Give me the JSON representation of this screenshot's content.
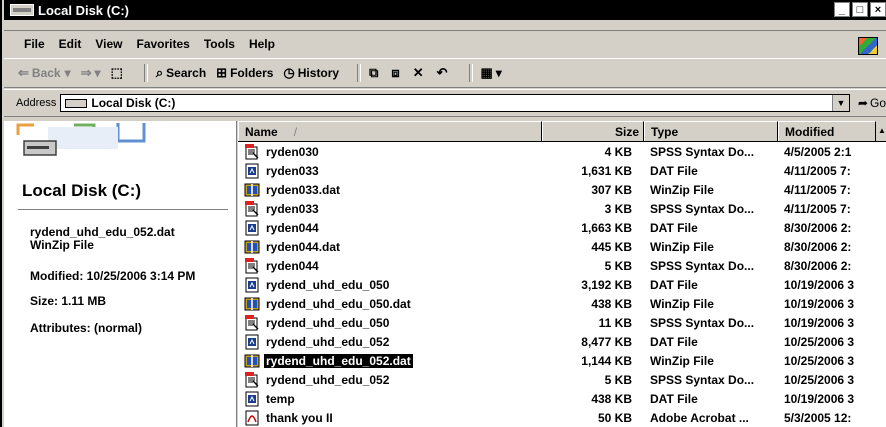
{
  "window": {
    "title": "Local Disk (C:)",
    "buttons": {
      "minimize": "_",
      "maximize": "□",
      "close": "×"
    }
  },
  "menu": [
    "File",
    "Edit",
    "View",
    "Favorites",
    "Tools",
    "Help"
  ],
  "toolbar": {
    "back_label": "Back",
    "search_label": "Search",
    "folders_label": "Folders",
    "history_label": "History"
  },
  "address": {
    "label": "Address",
    "value": "Local Disk (C:)",
    "go_label": "Go"
  },
  "details": {
    "title": "Local Disk (C:)",
    "selected_name": "rydend_uhd_edu_052.dat",
    "selected_type": "WinZip File",
    "modified": "Modified: 10/25/2006 3:14 PM",
    "size": "Size: 1.11 MB",
    "attributes": "Attributes: (normal)"
  },
  "columns": {
    "name": "Name",
    "sort_glyph": "/",
    "size": "Size",
    "type": "Type",
    "modified": "Modified"
  },
  "files": [
    {
      "name": "ryden030",
      "size": "4 KB",
      "type": "SPSS Syntax Do...",
      "modified": "4/5/2005 2:1",
      "icon": "spss-syntax-icon"
    },
    {
      "name": "ryden033",
      "size": "1,631 KB",
      "type": "DAT File",
      "modified": "4/11/2005 7:",
      "icon": "dat-file-icon"
    },
    {
      "name": "ryden033.dat",
      "size": "307 KB",
      "type": "WinZip File",
      "modified": "4/11/2005 7:",
      "icon": "winzip-icon"
    },
    {
      "name": "ryden033",
      "size": "3 KB",
      "type": "SPSS Syntax Do...",
      "modified": "4/11/2005 7:",
      "icon": "spss-syntax-icon"
    },
    {
      "name": "ryden044",
      "size": "1,663 KB",
      "type": "DAT File",
      "modified": "8/30/2006 2:",
      "icon": "dat-file-icon"
    },
    {
      "name": "ryden044.dat",
      "size": "445 KB",
      "type": "WinZip File",
      "modified": "8/30/2006 2:",
      "icon": "winzip-icon"
    },
    {
      "name": "ryden044",
      "size": "5 KB",
      "type": "SPSS Syntax Do...",
      "modified": "8/30/2006 2:",
      "icon": "spss-syntax-icon"
    },
    {
      "name": "rydend_uhd_edu_050",
      "size": "3,192 KB",
      "type": "DAT File",
      "modified": "10/19/2006 3",
      "icon": "dat-file-icon"
    },
    {
      "name": "rydend_uhd_edu_050.dat",
      "size": "438 KB",
      "type": "WinZip File",
      "modified": "10/19/2006 3",
      "icon": "winzip-icon"
    },
    {
      "name": "rydend_uhd_edu_050",
      "size": "11 KB",
      "type": "SPSS Syntax Do...",
      "modified": "10/19/2006 3",
      "icon": "spss-syntax-icon"
    },
    {
      "name": "rydend_uhd_edu_052",
      "size": "8,477 KB",
      "type": "DAT File",
      "modified": "10/25/2006 3",
      "icon": "dat-file-icon"
    },
    {
      "name": "rydend_uhd_edu_052.dat",
      "size": "1,144 KB",
      "type": "WinZip File",
      "modified": "10/25/2006 3",
      "icon": "winzip-icon",
      "selected": true
    },
    {
      "name": "rydend_uhd_edu_052",
      "size": "5 KB",
      "type": "SPSS Syntax Do...",
      "modified": "10/25/2006 3",
      "icon": "spss-syntax-icon"
    },
    {
      "name": "temp",
      "size": "438 KB",
      "type": "DAT File",
      "modified": "10/19/2006 3",
      "icon": "dat-file-icon"
    },
    {
      "name": "thank you II",
      "size": "50 KB",
      "type": "Adobe Acrobat ...",
      "modified": "5/3/2005 12:",
      "icon": "pdf-icon"
    }
  ]
}
